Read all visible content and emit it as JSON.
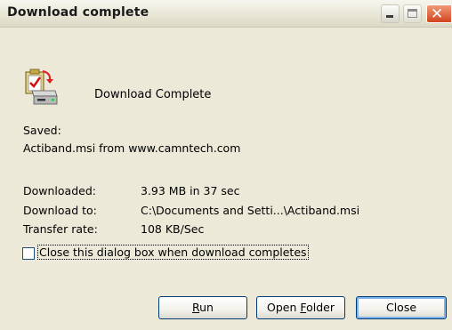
{
  "window": {
    "title": "Download complete",
    "controls": [
      "minimize-icon",
      "maximize-icon",
      "close-icon"
    ]
  },
  "header": {
    "icon": "download-complete-icon",
    "text": "Download Complete"
  },
  "saved": {
    "label": "Saved:",
    "value": "Actiband.msi from www.camntech.com"
  },
  "details": [
    {
      "label": "Downloaded:",
      "value": "3.93 MB in 37 sec"
    },
    {
      "label": "Download to:",
      "value": "C:\\Documents and Setti...\\Actiband.msi"
    },
    {
      "label": "Transfer rate:",
      "value": "108 KB/Sec"
    }
  ],
  "close_when_done": {
    "label": "Close this dialog box when download completes",
    "checked": false
  },
  "buttons": {
    "run": {
      "accel": "R",
      "rest": "un"
    },
    "open_folder": {
      "pre": "Open ",
      "accel": "F",
      "rest": "older"
    },
    "close": "Close"
  }
}
